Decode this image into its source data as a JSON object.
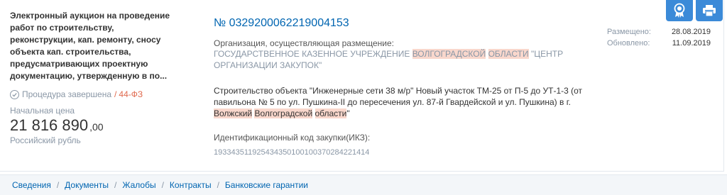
{
  "left": {
    "title": "Электронный аукцион на проведение работ по строительству, реконструкции, кап. ремонту, сносу объекта кап. строительства, предусматривающих проектную документацию, утвержденную в по...",
    "status": "Процедура завершена",
    "law_sep": "/",
    "law": "44-ФЗ",
    "price_label": "Начальная цена",
    "price_main": "21 816 890",
    "price_cents": ",00",
    "currency": "Российский рубль"
  },
  "mid": {
    "number": "№ 0329200062219004153",
    "org_label": "Организация, осуществляющая размещение:",
    "org_pre": "Государственное казенное учреждение ",
    "org_hl1": "Волгоградской",
    "org_space": " ",
    "org_hl2": "области",
    "org_post": " \"Центр организации закупок\"",
    "desc_pre": "Строительство объекта  \"Инженерные сети 38 м/р\"  Новый участок ТМ-25 от П-5 до УТ-1-3 (от павильона № 5 по ул. Пушкина-II до пересечения ул. 87-й Гвардейской и ул. Пушкина) в г. ",
    "desc_hl1": "Волжский",
    "desc_space": " ",
    "desc_hl2": "Волгоградской",
    "desc_space2": " ",
    "desc_hl3": "области",
    "desc_post": "\"",
    "ikz_label": "Идентификационный код закупки(ИКЗ):",
    "ikz": "193343511925434350100100370284221414"
  },
  "right": {
    "posted_label": "Размещено:",
    "posted_value": "28.08.2019",
    "updated_label": "Обновлено:",
    "updated_value": "11.09.2019"
  },
  "icons": {
    "award": "award-icon",
    "print": "printer-icon",
    "accent": "#3b8ad8"
  },
  "tabs": [
    {
      "label": "Сведения"
    },
    {
      "label": "Документы"
    },
    {
      "label": "Жалобы"
    },
    {
      "label": "Контракты"
    },
    {
      "label": "Банковские гарантии"
    }
  ],
  "tab_separator": "/"
}
